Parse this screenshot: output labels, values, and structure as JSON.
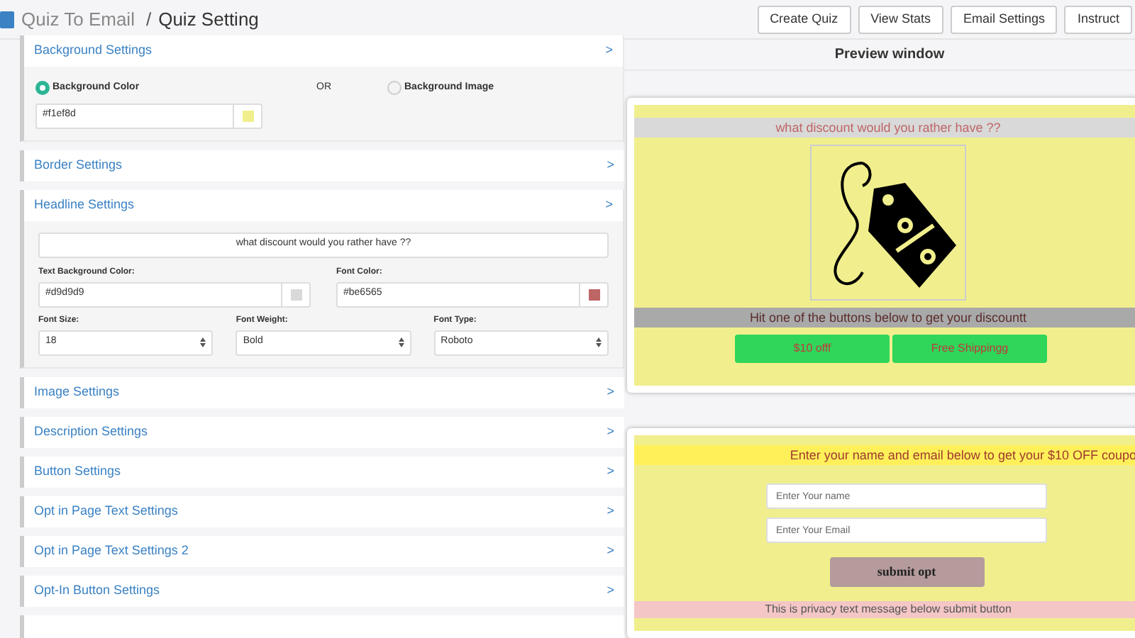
{
  "header": {
    "app_name": "Quiz To Email",
    "separator": "/",
    "page_title": "Quiz Setting",
    "buttons": [
      "Create Quiz",
      "View Stats",
      "Email Settings",
      "Instruct"
    ]
  },
  "sections": [
    {
      "kind": "background",
      "title": "Background Settings",
      "arrow": ">",
      "options": [
        {
          "label": "Background Color",
          "selected": true
        },
        {
          "label": "Background Image",
          "selected": false
        }
      ],
      "or_label": "OR",
      "color_value": "#f1ef8d"
    },
    {
      "kind": "plain",
      "title": "Border Settings",
      "arrow": ">"
    },
    {
      "kind": "headline",
      "title": "Headline Settings",
      "arrow": ">",
      "headline_text": "what discount would you rather have ??",
      "fields": [
        {
          "label": "Text Background Color:",
          "value": "#d9d9d9"
        },
        {
          "label": "Font Color:",
          "value": "#be6565"
        }
      ],
      "selects": [
        {
          "label": "Font Size:",
          "value": "18"
        },
        {
          "label": "Font Weight:",
          "value": "Bold"
        },
        {
          "label": "Font Type:",
          "value": "Roboto"
        }
      ]
    },
    {
      "kind": "plain",
      "title": "Image Settings",
      "arrow": ">"
    },
    {
      "kind": "plain",
      "title": "Description Settings",
      "arrow": ">"
    },
    {
      "kind": "plain",
      "title": "Button Settings",
      "arrow": ">"
    },
    {
      "kind": "plain",
      "title": "Opt in Page Text Settings",
      "arrow": ">"
    },
    {
      "kind": "plain",
      "title": "Opt in Page Text Settings 2",
      "arrow": ">"
    },
    {
      "kind": "plain",
      "title": "Opt-In Button Settings",
      "arrow": ">"
    },
    {
      "kind": "cut"
    }
  ],
  "preview": {
    "title": "Preview window",
    "quiz_card": {
      "headline": "what discount would you rather have ??",
      "description": "Hit one of the buttons below to get your discountt",
      "buttons": [
        "$10 offf",
        "Free Shippingg"
      ]
    },
    "optin_card": {
      "headline": "Enter your name and email below to get your $10 OFF coupo",
      "fields": [
        {
          "placeholder": "Enter Your name"
        },
        {
          "placeholder": "Enter Your Email"
        }
      ],
      "submit": "submit opt",
      "privacy": "This is privacy text message below submit button"
    }
  }
}
